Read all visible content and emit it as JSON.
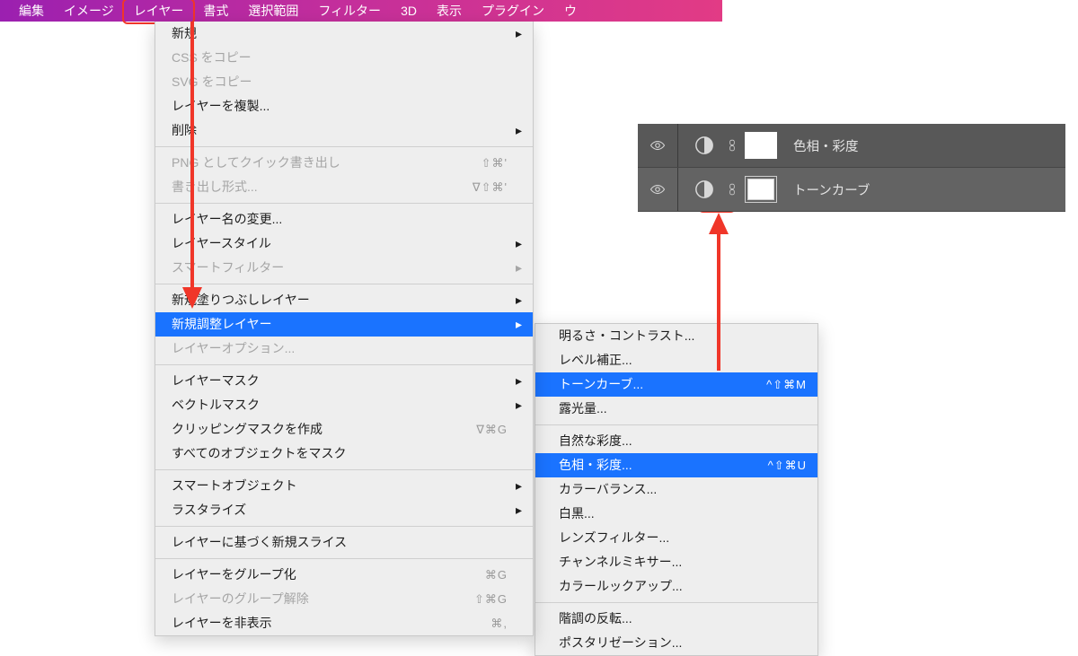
{
  "menubar": {
    "items": [
      {
        "label": "編集"
      },
      {
        "label": "イメージ"
      },
      {
        "label": "レイヤー",
        "active": true
      },
      {
        "label": "書式"
      },
      {
        "label": "選択範囲"
      },
      {
        "label": "フィルター"
      },
      {
        "label": "3D"
      },
      {
        "label": "表示"
      },
      {
        "label": "プラグイン"
      },
      {
        "label": "ウ"
      }
    ]
  },
  "dropdown": [
    {
      "label": "新規",
      "sub": true
    },
    {
      "label": "CSS をコピー",
      "disabled": true
    },
    {
      "label": "SVG をコピー",
      "disabled": true
    },
    {
      "label": "レイヤーを複製..."
    },
    {
      "label": "削除",
      "sub": true
    },
    {
      "sep": true
    },
    {
      "label": "PNG としてクイック書き出し",
      "disabled": true,
      "shortcut": "⇧⌘'"
    },
    {
      "label": "書き出し形式...",
      "disabled": true,
      "shortcut": "∇⇧⌘'",
      "sub": false
    },
    {
      "sep": true
    },
    {
      "label": "レイヤー名の変更..."
    },
    {
      "label": "レイヤースタイル",
      "sub": true
    },
    {
      "label": "スマートフィルター",
      "disabled": true,
      "sub": true
    },
    {
      "sep": true
    },
    {
      "label": "新規塗りつぶしレイヤー",
      "sub": true
    },
    {
      "label": "新規調整レイヤー",
      "sub": true,
      "selected": true
    },
    {
      "label": "レイヤーオプション...",
      "disabled": true
    },
    {
      "sep": true
    },
    {
      "label": "レイヤーマスク",
      "sub": true
    },
    {
      "label": "ベクトルマスク",
      "sub": true
    },
    {
      "label": "クリッピングマスクを作成",
      "shortcut": "∇⌘G"
    },
    {
      "label": "すべてのオブジェクトをマスク"
    },
    {
      "sep": true
    },
    {
      "label": "スマートオブジェクト",
      "sub": true
    },
    {
      "label": "ラスタライズ",
      "sub": true
    },
    {
      "sep": true
    },
    {
      "label": "レイヤーに基づく新規スライス"
    },
    {
      "sep": true
    },
    {
      "label": "レイヤーをグループ化",
      "shortcut": "⌘G"
    },
    {
      "label": "レイヤーのグループ解除",
      "disabled": true,
      "shortcut": "⇧⌘G"
    },
    {
      "label": "レイヤーを非表示",
      "shortcut": "⌘,"
    }
  ],
  "submenu": [
    {
      "label": "明るさ・コントラスト..."
    },
    {
      "label": "レベル補正..."
    },
    {
      "label": "トーンカーブ...",
      "shortcut": "^⇧⌘M",
      "selected": true
    },
    {
      "label": "露光量..."
    },
    {
      "sep": true
    },
    {
      "label": "自然な彩度..."
    },
    {
      "label": "色相・彩度...",
      "shortcut": "^⇧⌘U",
      "selected": true
    },
    {
      "label": "カラーバランス..."
    },
    {
      "label": "白黒..."
    },
    {
      "label": "レンズフィルター..."
    },
    {
      "label": "チャンネルミキサー..."
    },
    {
      "label": "カラールックアップ..."
    },
    {
      "sep": true
    },
    {
      "label": "階調の反転..."
    },
    {
      "label": "ポスタリゼーション..."
    }
  ],
  "layers": [
    {
      "name": "色相・彩度",
      "mask": "plain"
    },
    {
      "name": "トーンカーブ",
      "mask": "masked",
      "highlight": true
    }
  ]
}
